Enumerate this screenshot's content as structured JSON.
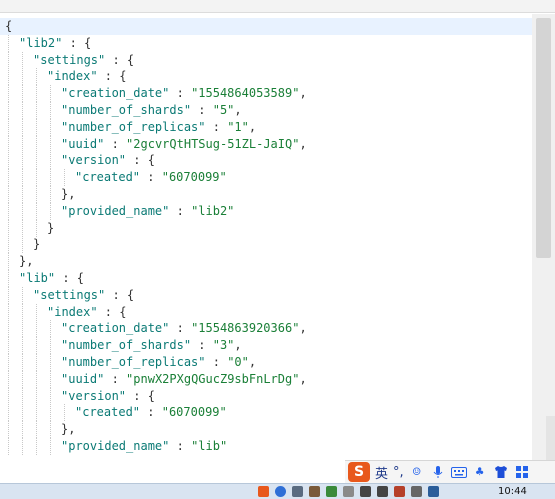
{
  "json_lines": [
    {
      "indent": 0,
      "parts": [
        {
          "t": "{",
          "c": "p"
        }
      ],
      "hl": true
    },
    {
      "indent": 1,
      "parts": [
        {
          "t": "\"lib2\"",
          "c": "k"
        },
        {
          "t": " : {",
          "c": "p"
        }
      ]
    },
    {
      "indent": 2,
      "parts": [
        {
          "t": "\"settings\"",
          "c": "k"
        },
        {
          "t": " : {",
          "c": "p"
        }
      ]
    },
    {
      "indent": 3,
      "parts": [
        {
          "t": "\"index\"",
          "c": "k"
        },
        {
          "t": " : {",
          "c": "p"
        }
      ]
    },
    {
      "indent": 4,
      "parts": [
        {
          "t": "\"creation_date\"",
          "c": "k"
        },
        {
          "t": " : ",
          "c": "p"
        },
        {
          "t": "\"1554864053589\"",
          "c": "s"
        },
        {
          "t": ",",
          "c": "p"
        }
      ]
    },
    {
      "indent": 4,
      "parts": [
        {
          "t": "\"number_of_shards\"",
          "c": "k"
        },
        {
          "t": " : ",
          "c": "p"
        },
        {
          "t": "\"5\"",
          "c": "s"
        },
        {
          "t": ",",
          "c": "p"
        }
      ]
    },
    {
      "indent": 4,
      "parts": [
        {
          "t": "\"number_of_replicas\"",
          "c": "k"
        },
        {
          "t": " : ",
          "c": "p"
        },
        {
          "t": "\"1\"",
          "c": "s"
        },
        {
          "t": ",",
          "c": "p"
        }
      ]
    },
    {
      "indent": 4,
      "parts": [
        {
          "t": "\"uuid\"",
          "c": "k"
        },
        {
          "t": " : ",
          "c": "p"
        },
        {
          "t": "\"2gcvrQtHTSug-51ZL-JaIQ\"",
          "c": "s"
        },
        {
          "t": ",",
          "c": "p"
        }
      ]
    },
    {
      "indent": 4,
      "parts": [
        {
          "t": "\"version\"",
          "c": "k"
        },
        {
          "t": " : {",
          "c": "p"
        }
      ]
    },
    {
      "indent": 5,
      "parts": [
        {
          "t": "\"created\"",
          "c": "k"
        },
        {
          "t": " : ",
          "c": "p"
        },
        {
          "t": "\"6070099\"",
          "c": "s"
        }
      ]
    },
    {
      "indent": 4,
      "parts": [
        {
          "t": "},",
          "c": "p"
        }
      ]
    },
    {
      "indent": 4,
      "parts": [
        {
          "t": "\"provided_name\"",
          "c": "k"
        },
        {
          "t": " : ",
          "c": "p"
        },
        {
          "t": "\"lib2\"",
          "c": "s"
        }
      ]
    },
    {
      "indent": 3,
      "parts": [
        {
          "t": "}",
          "c": "p"
        }
      ]
    },
    {
      "indent": 2,
      "parts": [
        {
          "t": "}",
          "c": "p"
        }
      ]
    },
    {
      "indent": 1,
      "parts": [
        {
          "t": "},",
          "c": "p"
        }
      ]
    },
    {
      "indent": 1,
      "parts": [
        {
          "t": "\"lib\"",
          "c": "k"
        },
        {
          "t": " : {",
          "c": "p"
        }
      ]
    },
    {
      "indent": 2,
      "parts": [
        {
          "t": "\"settings\"",
          "c": "k"
        },
        {
          "t": " : {",
          "c": "p"
        }
      ]
    },
    {
      "indent": 3,
      "parts": [
        {
          "t": "\"index\"",
          "c": "k"
        },
        {
          "t": " : {",
          "c": "p"
        }
      ]
    },
    {
      "indent": 4,
      "parts": [
        {
          "t": "\"creation_date\"",
          "c": "k"
        },
        {
          "t": " : ",
          "c": "p"
        },
        {
          "t": "\"1554863920366\"",
          "c": "s"
        },
        {
          "t": ",",
          "c": "p"
        }
      ]
    },
    {
      "indent": 4,
      "parts": [
        {
          "t": "\"number_of_shards\"",
          "c": "k"
        },
        {
          "t": " : ",
          "c": "p"
        },
        {
          "t": "\"3\"",
          "c": "s"
        },
        {
          "t": ",",
          "c": "p"
        }
      ]
    },
    {
      "indent": 4,
      "parts": [
        {
          "t": "\"number_of_replicas\"",
          "c": "k"
        },
        {
          "t": " : ",
          "c": "p"
        },
        {
          "t": "\"0\"",
          "c": "s"
        },
        {
          "t": ",",
          "c": "p"
        }
      ]
    },
    {
      "indent": 4,
      "parts": [
        {
          "t": "\"uuid\"",
          "c": "k"
        },
        {
          "t": " : ",
          "c": "p"
        },
        {
          "t": "\"pnwX2PXgQGucZ9sbFnLrDg\"",
          "c": "s"
        },
        {
          "t": ",",
          "c": "p"
        }
      ]
    },
    {
      "indent": 4,
      "parts": [
        {
          "t": "\"version\"",
          "c": "k"
        },
        {
          "t": " : {",
          "c": "p"
        }
      ]
    },
    {
      "indent": 5,
      "parts": [
        {
          "t": "\"created\"",
          "c": "k"
        },
        {
          "t": " : ",
          "c": "p"
        },
        {
          "t": "\"6070099\"",
          "c": "s"
        }
      ]
    },
    {
      "indent": 4,
      "parts": [
        {
          "t": "},",
          "c": "p"
        }
      ]
    },
    {
      "indent": 4,
      "parts": [
        {
          "t": "\"provided_name\"",
          "c": "k"
        },
        {
          "t": " : ",
          "c": "p"
        },
        {
          "t": "\"lib\"",
          "c": "s"
        }
      ]
    }
  ],
  "ime_bar": {
    "logo": "S",
    "mode": "英",
    "punct": "°,",
    "icons": [
      "smiley-icon",
      "microphone-icon",
      "keyboard-icon",
      "skin-icon",
      "shirt-icon",
      "grid-icon"
    ]
  },
  "taskbar": {
    "clock": "10:44"
  },
  "colors": {
    "key": "#0b7a75",
    "string": "#1a7f37",
    "punct": "#333333",
    "ime_logo": "#e8581c"
  }
}
